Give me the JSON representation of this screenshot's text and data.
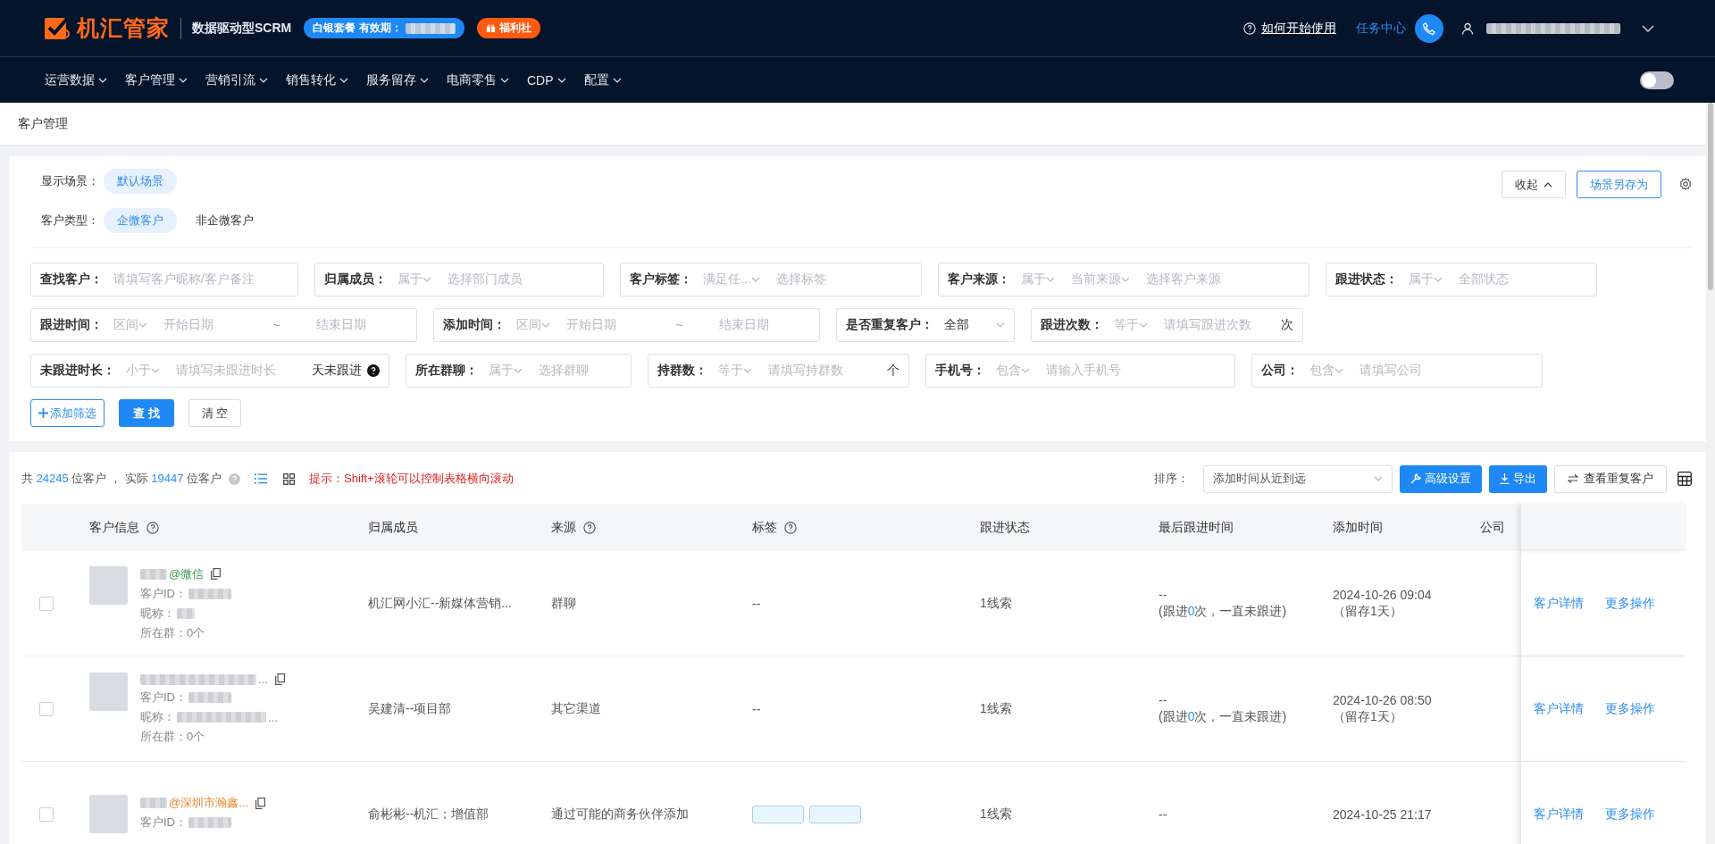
{
  "header": {
    "logo_text": "机汇管家",
    "tagline": "数据驱动型SCRM",
    "plan": {
      "label": "白银套餐 有效期："
    },
    "perk": {
      "label": "福利社"
    },
    "help_link": "如何开始使用",
    "task_center": "任务中心"
  },
  "nav": {
    "items": [
      {
        "label": "运营数据"
      },
      {
        "label": "客户管理"
      },
      {
        "label": "营销引流"
      },
      {
        "label": "销售转化"
      },
      {
        "label": "服务留存"
      },
      {
        "label": "电商零售"
      },
      {
        "label": "CDP"
      },
      {
        "label": "配置"
      }
    ],
    "toggle": {
      "on": false
    }
  },
  "breadcrumb": "客户管理",
  "scenes": [
    {
      "label": "显示场景：",
      "chips": [
        {
          "label": "默认场景",
          "selected": true
        }
      ]
    },
    {
      "label": "客户类型：",
      "chips": [
        {
          "label": "企微客户",
          "selected": true
        },
        {
          "label": "非企微客户",
          "selected": false
        }
      ]
    }
  ],
  "scene_buttons": {
    "collapse": "收起",
    "save_as": "场景另存为"
  },
  "filter_rows": [
    [
      {
        "label": "查找客户：",
        "parts": [
          {
            "kind": "placeholder",
            "text": "请填写客户昵称/客户备注"
          }
        ]
      },
      {
        "label": "归属成员：",
        "parts": [
          {
            "kind": "select",
            "text": "属于"
          },
          {
            "kind": "placeholder",
            "text": "选择部门成员"
          }
        ]
      },
      {
        "label": "客户标签：",
        "parts": [
          {
            "kind": "select",
            "text": "满足任..."
          },
          {
            "kind": "placeholder",
            "text": "选择标签"
          }
        ]
      },
      {
        "label": "客户来源：",
        "parts": [
          {
            "kind": "select",
            "text": "属于"
          },
          {
            "kind": "select",
            "text": "当前来源"
          },
          {
            "kind": "placeholder",
            "text": "选择客户来源"
          }
        ]
      },
      {
        "label": "跟进状态：",
        "parts": [
          {
            "kind": "select",
            "text": "属于"
          },
          {
            "kind": "placeholder",
            "text": "全部状态"
          }
        ]
      }
    ],
    [
      {
        "label": "跟进时间：",
        "parts": [
          {
            "kind": "select",
            "text": "区间"
          },
          {
            "kind": "placeholder",
            "text": "开始日期"
          },
          {
            "kind": "sep",
            "text": "~"
          },
          {
            "kind": "placeholder",
            "text": "结束日期"
          }
        ]
      },
      {
        "label": "添加时间：",
        "parts": [
          {
            "kind": "select",
            "text": "区间"
          },
          {
            "kind": "placeholder",
            "text": "开始日期"
          },
          {
            "kind": "sep",
            "text": "~"
          },
          {
            "kind": "placeholder",
            "text": "结束日期"
          }
        ]
      },
      {
        "label": "是否重复客户：",
        "parts": [
          {
            "kind": "value",
            "text": "全部"
          },
          {
            "kind": "caret"
          }
        ]
      },
      {
        "label": "跟进次数：",
        "parts": [
          {
            "kind": "select",
            "text": "等于"
          },
          {
            "kind": "placeholder",
            "text": "请填写跟进次数"
          },
          {
            "kind": "suffix",
            "text": "次"
          }
        ]
      }
    ],
    [
      {
        "label": "未跟进时长：",
        "parts": [
          {
            "kind": "select",
            "text": "小于"
          },
          {
            "kind": "placeholder",
            "text": "请填写未跟进时长"
          },
          {
            "kind": "suffix",
            "text": "天未跟进"
          },
          {
            "kind": "help"
          }
        ]
      },
      {
        "label": "所在群聊：",
        "parts": [
          {
            "kind": "select",
            "text": "属于"
          },
          {
            "kind": "placeholder",
            "text": "选择群聊"
          }
        ]
      },
      {
        "label": "持群数：",
        "parts": [
          {
            "kind": "select",
            "text": "等于"
          },
          {
            "kind": "placeholder",
            "text": "请填写持群数"
          },
          {
            "kind": "suffix",
            "text": "个"
          }
        ]
      },
      {
        "label": "手机号：",
        "parts": [
          {
            "kind": "select",
            "text": "包含"
          },
          {
            "kind": "placeholder",
            "text": "请输入手机号"
          }
        ]
      },
      {
        "label": "公司：",
        "parts": [
          {
            "kind": "select",
            "text": "包含"
          },
          {
            "kind": "placeholder",
            "text": "请填写公司"
          }
        ]
      }
    ]
  ],
  "filter_actions": {
    "add": "添加筛选",
    "search": "查 找",
    "clear": "清 空"
  },
  "summary": {
    "parts": [
      {
        "kind": "plain",
        "text": "共 "
      },
      {
        "kind": "number",
        "text": "24245"
      },
      {
        "kind": "plain",
        "text": " 位客户 ， 实际 "
      },
      {
        "kind": "number",
        "text": "19447"
      },
      {
        "kind": "plain",
        "text": " 位客户"
      }
    ],
    "views": [
      {
        "kind": "list",
        "selected": true
      },
      {
        "kind": "grid",
        "selected": false
      }
    ],
    "hint": "提示：Shift+滚轮可以控制表格横向滚动"
  },
  "toolbar": {
    "sort_label": "排序：",
    "sort_value": "添加时间从近到远",
    "advanced": "高级设置",
    "export": "导出",
    "duplicates": "查看重复客户"
  },
  "table": {
    "columns": [
      {
        "label": "客户信息",
        "help": true
      },
      {
        "label": "归属成员",
        "help": false
      },
      {
        "label": "来源",
        "help": true
      },
      {
        "label": "标签",
        "help": true
      },
      {
        "label": "跟进状态",
        "help": false
      },
      {
        "label": "最后跟进时间",
        "help": false
      },
      {
        "label": "添加时间",
        "help": false
      },
      {
        "label": "公司",
        "help": false
      }
    ],
    "rows": [
      {
        "checked": false,
        "name_suffix": "",
        "source_tag": "@微信",
        "color": "#3a9a4a",
        "id_label": "客户ID：",
        "nick_label": "昵称：",
        "nick_suffix": "",
        "groups": "所在群：0个",
        "owner": "机汇网小汇--新媒体营销...",
        "source": "群聊",
        "tags": "--",
        "status": "1线索",
        "last_follow": "--",
        "follow_prefix": "(跟进",
        "follow_count": "0",
        "follow_suffix": "次，一直未跟进)",
        "added": "2024-10-26 09:04",
        "retention": "（留存1天）",
        "detail": "客户详情",
        "more": "更多操作"
      },
      {
        "checked": false,
        "name_suffix": "...",
        "source_tag": "",
        "id_label": "客户ID：",
        "nick_label": "昵称：",
        "nick_suffix": "...",
        "groups": "所在群：0个",
        "owner": "吴建清--项目部",
        "source": "其它渠道",
        "tags": "--",
        "status": "1线索",
        "last_follow": "--",
        "follow_prefix": "(跟进",
        "follow_count": "0",
        "follow_suffix": "次，一直未跟进)",
        "added": "2024-10-26 08:50",
        "retention": "（留存1天）",
        "detail": "客户详情",
        "more": "更多操作"
      },
      {
        "checked": false,
        "name_suffix": "",
        "source_tag": "@深圳市瀚鑫...",
        "color": "#e8872f",
        "id_label": "客户ID：",
        "nick_label": "",
        "nick_suffix": "",
        "groups": "",
        "owner": "俞彬彬--机汇；增值部",
        "source": "通过可能的商务伙伴添加",
        "tags": "",
        "tag_chips": [
          {
            "kind": "blurred"
          },
          {
            "kind": "blurred"
          }
        ],
        "status": "1线索",
        "last_follow": "--",
        "follow_prefix": "",
        "follow_count": "",
        "follow_suffix": "",
        "added": "2024-10-25 21:17",
        "retention": "",
        "detail": "客户详情",
        "more": "更多操作"
      }
    ]
  }
}
